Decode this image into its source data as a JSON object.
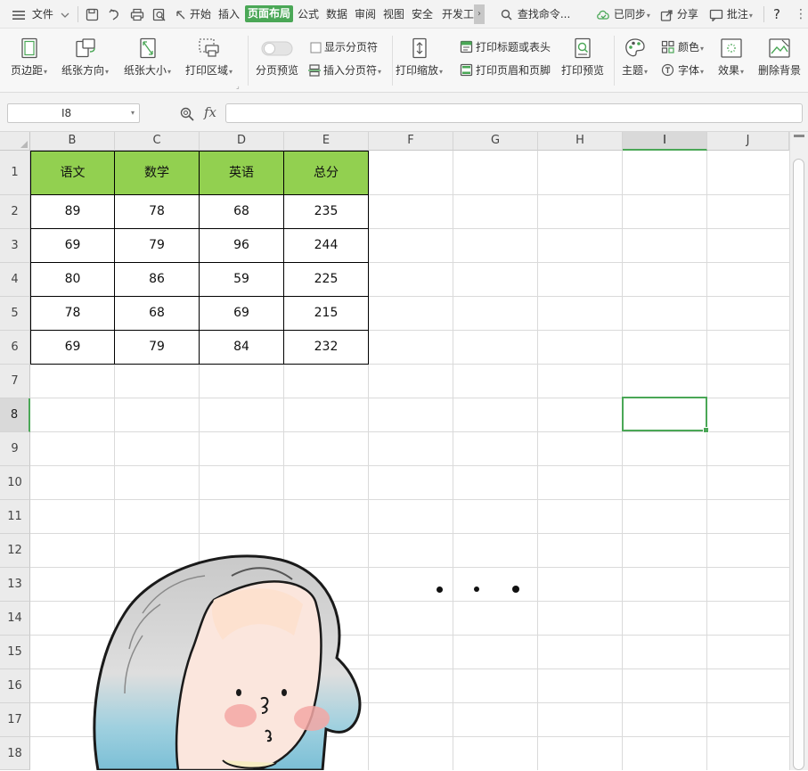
{
  "menu": {
    "file": "文件",
    "tabs": [
      "开始",
      "插入",
      "页面布局",
      "公式",
      "数据",
      "审阅",
      "视图",
      "安全",
      "开发工"
    ],
    "active_tab": "页面布局",
    "search": "查找命令...",
    "sync": "已同步",
    "share": "分享",
    "comment": "批注",
    "help": "?"
  },
  "ribbon": {
    "margins": "页边距",
    "orientation": "纸张方向",
    "size": "纸张大小",
    "print_area": "打印区域",
    "page_break_preview": "分页预览",
    "show_page_breaks": "显示分页符",
    "insert_page_break": "插入分页符",
    "print_scaling": "打印缩放",
    "print_titles": "打印标题或表头",
    "print_header_footer": "打印页眉和页脚",
    "print_preview": "打印预览",
    "theme": "主题",
    "colors": "颜色",
    "fonts": "字体",
    "effects": "效果",
    "delete_background": "删除背景"
  },
  "formula_bar": {
    "name_box": "I8",
    "fx": "fx",
    "value": ""
  },
  "sheet": {
    "columns": [
      "B",
      "C",
      "D",
      "E",
      "F",
      "G",
      "H",
      "I",
      "J"
    ],
    "selected_column": "I",
    "rows": [
      "1",
      "2",
      "3",
      "4",
      "5",
      "6",
      "7",
      "8",
      "9",
      "10",
      "11",
      "12",
      "13",
      "14",
      "15",
      "16",
      "17",
      "18"
    ],
    "selected_row": "8",
    "selected_cell": "I8",
    "table": {
      "headers": [
        "语文",
        "数学",
        "英语",
        "总分"
      ],
      "rows": [
        [
          "89",
          "78",
          "68",
          "235"
        ],
        [
          "69",
          "79",
          "96",
          "244"
        ],
        [
          "80",
          "86",
          "59",
          "225"
        ],
        [
          "78",
          "68",
          "69",
          "215"
        ],
        [
          "69",
          "79",
          "84",
          "232"
        ]
      ],
      "header_color": "#92d050"
    }
  },
  "colors": {
    "accent": "#4aa756",
    "grid": "#dadada"
  }
}
